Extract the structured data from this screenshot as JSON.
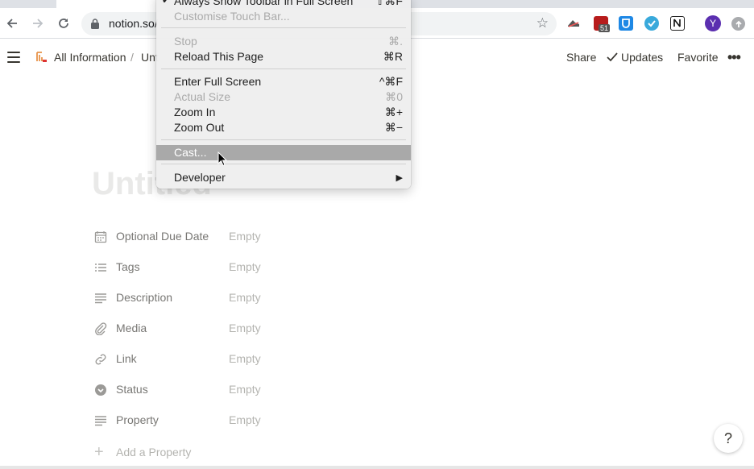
{
  "browser": {
    "url": "notion.so/",
    "back_icon": "back-arrow-icon",
    "forward_icon": "forward-arrow-icon",
    "reload_icon": "reload-icon",
    "ext_badge": "51",
    "profile_initial": "Y",
    "colors": {
      "tabstrip": "#dee1e6",
      "omnibox": "#f1f3f4",
      "avatar": "#5b2fb0"
    }
  },
  "notion_header": {
    "breadcrumb_1": "All Information",
    "breadcrumb_sep": "/",
    "breadcrumb_2": "Unt",
    "share": "Share",
    "updates": "Updates",
    "favorite": "Favorite",
    "more": "•••"
  },
  "page": {
    "title": "Untitled",
    "properties": [
      {
        "name": "Optional Due Date",
        "value": "Empty",
        "icon": "calendar-icon"
      },
      {
        "name": "Tags",
        "value": "Empty",
        "icon": "list-icon"
      },
      {
        "name": "Description",
        "value": "Empty",
        "icon": "text-icon"
      },
      {
        "name": "Media",
        "value": "Empty",
        "icon": "paperclip-icon"
      },
      {
        "name": "Link",
        "value": "Empty",
        "icon": "link-icon"
      },
      {
        "name": "Status",
        "value": "Empty",
        "icon": "select-icon"
      },
      {
        "name": "Property",
        "value": "Empty",
        "icon": "text-icon"
      }
    ],
    "add_property": "Add a Property",
    "help": "?"
  },
  "menu": {
    "items": [
      {
        "label": "Always Show Toolbar in Full Screen",
        "shortcut": "⇧⌘F",
        "checked": true,
        "disabled": false
      },
      {
        "label": "Customise Touch Bar...",
        "shortcut": "",
        "disabled": true
      },
      {
        "label": "Stop",
        "shortcut": "⌘.",
        "disabled": true
      },
      {
        "label": "Reload This Page",
        "shortcut": "⌘R",
        "disabled": false
      },
      {
        "label": "Enter Full Screen",
        "shortcut": "^⌘F",
        "disabled": false
      },
      {
        "label": "Actual Size",
        "shortcut": "⌘0",
        "disabled": true
      },
      {
        "label": "Zoom In",
        "shortcut": "⌘+",
        "disabled": false
      },
      {
        "label": "Zoom Out",
        "shortcut": "⌘−",
        "disabled": false
      },
      {
        "label": "Cast...",
        "shortcut": "",
        "highlighted": true
      },
      {
        "label": "Developer",
        "shortcut": "▶",
        "submenu": true
      }
    ]
  }
}
